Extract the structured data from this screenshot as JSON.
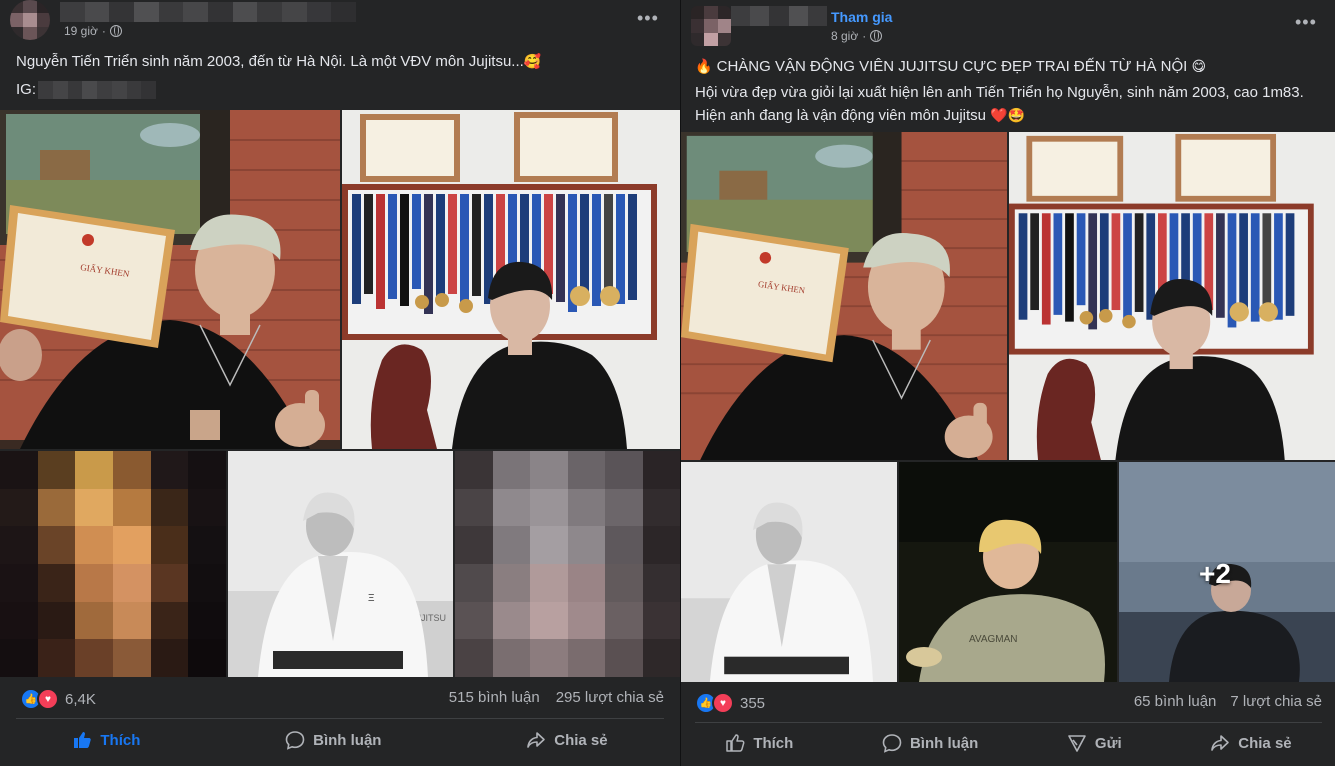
{
  "left_post": {
    "time": "19 giờ",
    "caption": "Nguyễn Tiến Triển sinh năm 2003, đến từ Hà Nội. Là một VĐV môn Jujitsu...",
    "ig_label": "IG:",
    "reactions_count": "6,4K",
    "comments": "515 bình luận",
    "shares": "295 lượt chia sẻ",
    "actions": {
      "like": "Thích",
      "comment": "Bình luận",
      "share": "Chia sẻ"
    }
  },
  "right_post": {
    "join_label": "Tham gia",
    "time": "8 giờ",
    "headline": "CHÀNG VẬN ĐỘNG VIÊN JUJITSU CỰC ĐẸP TRAI ĐẾN TỪ HÀ NỘI",
    "body": "Hội vừa đẹp vừa giỏi lại xuất hiện lên anh Tiến Triển họ Nguyễn, sinh năm 2003, cao 1m83. Hiện anh đang là vận động viên môn Jujitsu",
    "more_photos": "+2",
    "reactions_count": "355",
    "comments": "65 bình luận",
    "shares": "7 lượt chia sẻ",
    "actions": {
      "like": "Thích",
      "comment": "Bình luận",
      "send": "Gửi",
      "share": "Chia sẻ"
    }
  },
  "icons": [
    "more-dots-icon",
    "globe-icon",
    "like-icon",
    "love-icon",
    "comment-icon",
    "share-icon",
    "send-icon"
  ],
  "colors": {
    "background": "#242526",
    "accent": "#1877f2",
    "link": "#4599ff",
    "love": "#f33e58",
    "secondary_text": "#b0b3b8"
  }
}
